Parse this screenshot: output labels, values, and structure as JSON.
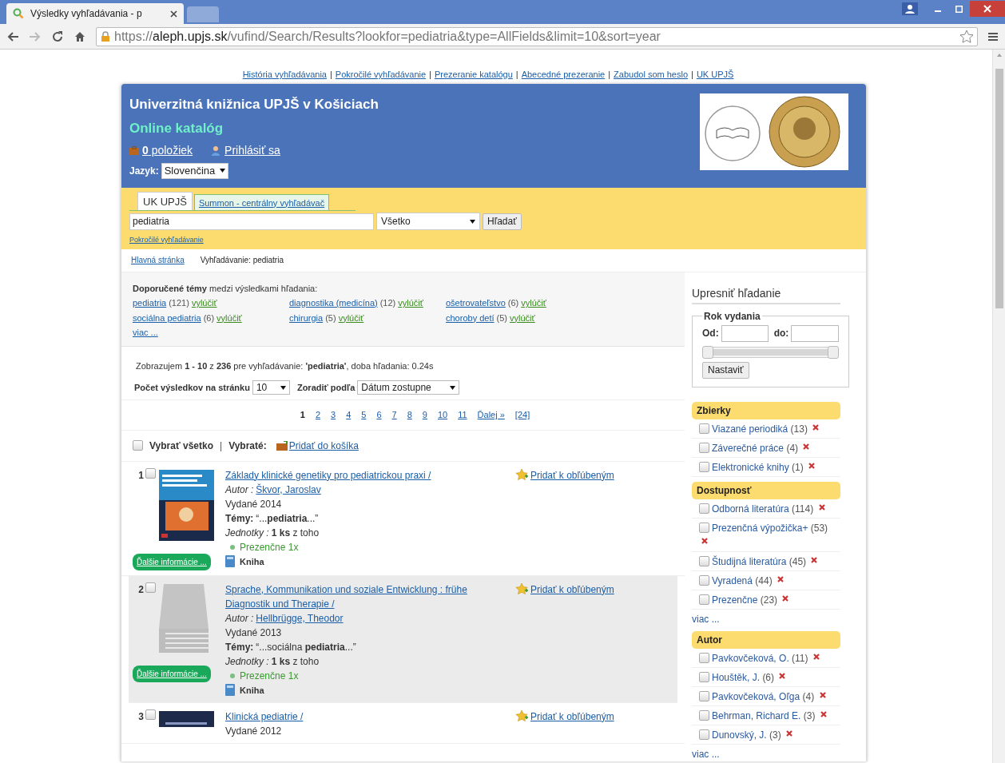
{
  "browser": {
    "tab_title": "Výsledky vyhľadávania - p",
    "url_scheme": "https://",
    "url_host": "aleph.upjs.sk",
    "url_path": "/vufind/Search/Results?lookfor=pediatria&type=AllFields&limit=10&sort=year"
  },
  "link_separator": "|",
  "top_links": [
    "História vyhľadávania",
    "Pokročilé vyhľadávanie",
    "Prezeranie katalógu",
    "Abecedné prezeranie",
    "Zabudol som heslo",
    "UK UPJŠ"
  ],
  "header": {
    "title": "Univerzitná knižnica UPJŠ v Košiciach",
    "subtitle": "Online katalóg",
    "cart_count": "0",
    "cart_label": "položiek",
    "login": "Prihlásiť sa",
    "language_label": "Jazyk:",
    "language": "Slovenčina"
  },
  "search": {
    "tabs": [
      {
        "label": "UK UPJŠ",
        "selected": true
      },
      {
        "label": "Summon - centrálny vyhľadávač",
        "selected": false
      }
    ],
    "query": "pediatria",
    "type": "Všetko",
    "button": "Hľadať",
    "advanced": "Pokročilé vyhľadávanie"
  },
  "breadcrumb": [
    "Hlavná stránka",
    "Vyhľadávanie: pediatria"
  ],
  "topics": {
    "heading": "**Doporučené témy** medzi výsledkami hľadania:",
    "items": [
      {
        "name": "pediatria",
        "count": "(121)",
        "exclude": "vylúčiť"
      },
      {
        "name": "diagnostika (medicína)",
        "count": "(12)",
        "exclude": "vylúčiť"
      },
      {
        "name": "ošetrovateľstvo",
        "count": "(6)",
        "exclude": "vylúčiť"
      },
      {
        "name": "sociálna pediatria",
        "count": "(6)",
        "exclude": "vylúčiť"
      },
      {
        "name": "chirurgia",
        "count": "(5)",
        "exclude": "vylúčiť"
      },
      {
        "name": "choroby detí",
        "count": "(5)",
        "exclude": "vylúčiť"
      }
    ],
    "more": "viac ..."
  },
  "summary": "Zobrazujem **1 - 10** z **236** pre vyhľadávanie: **'pediatria'**, doba hľadania: 0.24s",
  "per_page_label": "Počet výsledkov na stránku",
  "per_page": "10",
  "sort_label": "Zoradiť podľa",
  "sort": "Dátum zostupne",
  "pagination": [
    {
      "label": "1",
      "selected": true
    },
    {
      "label": "2",
      "selected": false
    },
    {
      "label": "3",
      "selected": false
    },
    {
      "label": "4",
      "selected": false
    },
    {
      "label": "5",
      "selected": false
    },
    {
      "label": "6",
      "selected": false
    },
    {
      "label": "7",
      "selected": false
    },
    {
      "label": "8",
      "selected": false
    },
    {
      "label": "9",
      "selected": false
    },
    {
      "label": "10",
      "selected": false
    },
    {
      "label": "11",
      "selected": false
    },
    {
      "label": "Ďalej »",
      "selected": false
    },
    {
      "label": "[24]",
      "selected": false
    }
  ],
  "select_all_checked": false,
  "select_all": "Vybrať všetko",
  "action_separator": "|",
  "selected_label": "Vybraté:",
  "add_to_cart": "Pridať do košíka",
  "results": [
    {
      "number": "1",
      "checked": false,
      "kind": "cover",
      "shaded": false,
      "title": "Základy klinické genetiky pro pediatrickou praxi /",
      "author_label": "Autor :",
      "author": "Škvor, Jaroslav",
      "published": "Vydané 2014",
      "topics_label": "Témy:",
      "topics": "“...**pediatria**...”",
      "units_label": "Jednotky :",
      "units": "**1 ks** z toho",
      "availability": "Prezenčne 1x",
      "format": "Kniha",
      "more": "Ďalšie informácie ...",
      "favorite": "Pridať k obľúbeným"
    },
    {
      "number": "2",
      "checked": false,
      "kind": "generic",
      "shaded": true,
      "title": "Sprache, Kommunikation und soziale Entwicklung : frühe Diagnostik und Therapie /",
      "author_label": "Autor :",
      "author": "Hellbrügge, Theodor",
      "published": "Vydané 2013",
      "topics_label": "Témy:",
      "topics": "“...sociálna **pediatria**...”",
      "units_label": "Jednotky :",
      "units": "**1 ks** z toho",
      "availability": "Prezenčne 1x",
      "format": "Kniha",
      "more": "Ďalšie informácie ...",
      "favorite": "Pridať k obľúbeným"
    },
    {
      "number": "3",
      "checked": false,
      "kind": "dark",
      "shaded": false,
      "title": "Klinická pediatrie /",
      "published": "Vydané 2012",
      "favorite": "Pridať k obľúbeným"
    }
  ],
  "sidebar": {
    "title": "Upresniť hľadanie",
    "year": {
      "legend": "Rok vydania",
      "from_label": "Od:",
      "to_label": "do:",
      "level": 1,
      "button": "Nastaviť"
    },
    "facets": [
      {
        "title": "Zbierky",
        "items": [
          {
            "label": "Viazané periodiká",
            "count": "(13)",
            "checked": false
          },
          {
            "label": "Záverečné práce",
            "count": "(4)",
            "checked": false
          },
          {
            "label": "Elektronické knihy",
            "count": "(1)",
            "checked": false
          }
        ]
      },
      {
        "title": "Dostupnosť",
        "items": [
          {
            "label": "Odborná literatúra",
            "count": "(114)",
            "checked": false
          },
          {
            "label": "Prezenčná výpožička+",
            "count": "(53)",
            "checked": false
          },
          {
            "label": "Študijná literatúra",
            "count": "(45)",
            "checked": false
          },
          {
            "label": "Vyradená",
            "count": "(44)",
            "checked": false
          },
          {
            "label": "Prezenčne",
            "count": "(23)",
            "checked": false
          }
        ],
        "more": "viac ..."
      },
      {
        "title": "Autor",
        "items": [
          {
            "label": "Pavkovčeková, O.",
            "count": "(11)",
            "checked": false
          },
          {
            "label": "Houštěk, J.",
            "count": "(6)",
            "checked": false
          },
          {
            "label": "Pavkovčeková, Oľga",
            "count": "(4)",
            "checked": false
          },
          {
            "label": "Behrman, Richard E.",
            "count": "(3)",
            "checked": false
          },
          {
            "label": "Dunovský, J.",
            "count": "(3)",
            "checked": false
          }
        ],
        "more": "viac ..."
      }
    ]
  }
}
